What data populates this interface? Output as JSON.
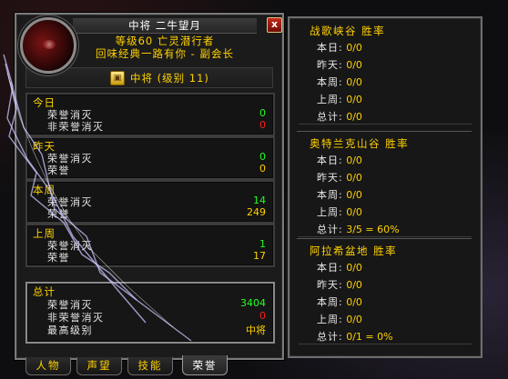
{
  "header": {
    "title": "中将 二牛望月",
    "subtitle_line1": "等级60 亡灵潜行者",
    "subtitle_line2": "回味经典一路有你 - 副会长",
    "close_label": "x"
  },
  "rank": {
    "label": "中将 (级别 11)"
  },
  "honor": {
    "today": {
      "title": "今日",
      "rows": [
        {
          "label": "荣誉消灭",
          "value": "0"
        },
        {
          "label": "非荣誉消灭",
          "value": "0"
        }
      ]
    },
    "yesterday": {
      "title": "昨天",
      "rows": [
        {
          "label": "荣誉消灭",
          "value": "0"
        },
        {
          "label": "荣誉",
          "value": "0"
        }
      ]
    },
    "this_week": {
      "title": "本周",
      "rows": [
        {
          "label": "荣誉消灭",
          "value": "14"
        },
        {
          "label": "荣誉",
          "value": "249"
        }
      ]
    },
    "last_week": {
      "title": "上周",
      "rows": [
        {
          "label": "荣誉消灭",
          "value": "1"
        },
        {
          "label": "荣誉",
          "value": "17"
        }
      ]
    },
    "total": {
      "title": "总计",
      "rows": [
        {
          "label": "荣誉消灭",
          "value": "3404"
        },
        {
          "label": "非荣誉消灭",
          "value": "0"
        },
        {
          "label": "最高级别",
          "value": "中将"
        }
      ]
    }
  },
  "tabs": [
    {
      "label": "人物",
      "active": false
    },
    {
      "label": "声望",
      "active": false
    },
    {
      "label": "技能",
      "active": false
    },
    {
      "label": "荣誉",
      "active": true
    }
  ],
  "battlegrounds": [
    {
      "title": "战歌峡谷 胜率",
      "rows": [
        {
          "label": "本日:",
          "value": "0/0"
        },
        {
          "label": "昨天:",
          "value": "0/0"
        },
        {
          "label": "本周:",
          "value": "0/0"
        },
        {
          "label": "上周:",
          "value": "0/0"
        },
        {
          "label": "总计:",
          "value": "0/0"
        }
      ]
    },
    {
      "title": "奥特兰克山谷 胜率",
      "rows": [
        {
          "label": "本日:",
          "value": "0/0"
        },
        {
          "label": "昨天:",
          "value": "0/0"
        },
        {
          "label": "本周:",
          "value": "0/0"
        },
        {
          "label": "上周:",
          "value": "0/0"
        },
        {
          "label": "总计:",
          "value": "3/5 = 60%"
        }
      ]
    },
    {
      "title": "阿拉希盆地 胜率",
      "rows": [
        {
          "label": "本日:",
          "value": "0/0"
        },
        {
          "label": "昨天:",
          "value": "0/0"
        },
        {
          "label": "本周:",
          "value": "0/0"
        },
        {
          "label": "上周:",
          "value": "0/0"
        },
        {
          "label": "总计:",
          "value": "0/1 = 0%"
        }
      ]
    }
  ],
  "colors": {
    "gold": "#ffd100",
    "green": "#20ff20",
    "red": "#ff2020",
    "white": "#e8e8e8"
  }
}
